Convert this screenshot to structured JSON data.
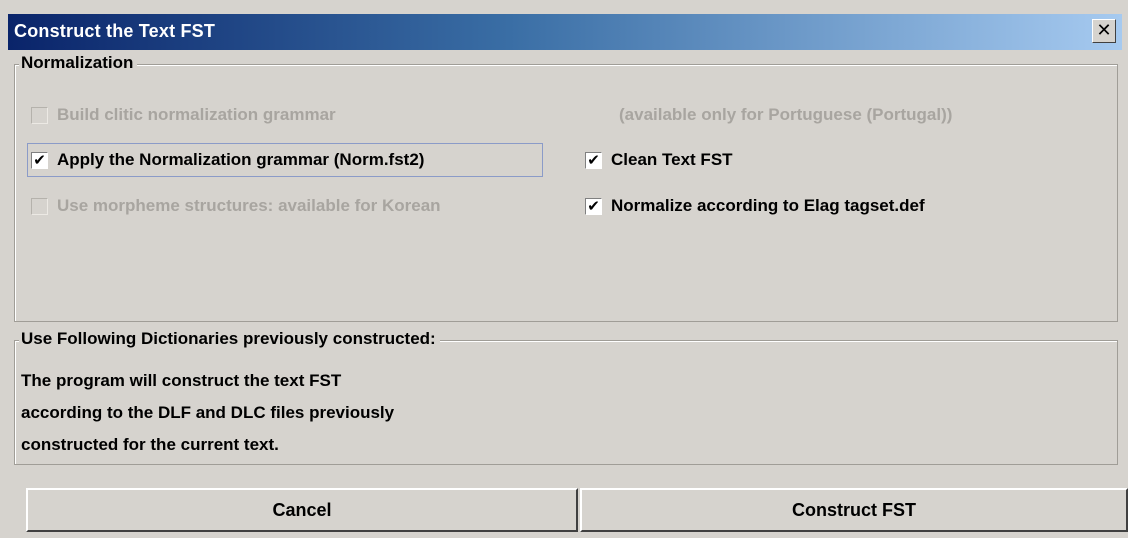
{
  "window": {
    "title": "Construct the Text FST",
    "close_glyph": "✕"
  },
  "normalization": {
    "legend": "Normalization",
    "build_clitic": {
      "label": "Build clitic normalization grammar",
      "checked": false,
      "enabled": false
    },
    "build_clitic_note": "(available only for Portuguese (Portugal))",
    "apply_norm": {
      "label": "Apply the Normalization grammar (Norm.fst2)",
      "checked": true,
      "enabled": true
    },
    "clean_text": {
      "label": "Clean Text FST",
      "checked": true,
      "enabled": true
    },
    "morpheme": {
      "label": "Use morpheme structures: available for Korean",
      "checked": false,
      "enabled": false
    },
    "elag": {
      "label": "Normalize according to Elag tagset.def",
      "checked": true,
      "enabled": true
    },
    "check_glyph": "✔"
  },
  "dictionaries": {
    "legend": "Use Following Dictionaries previously constructed:",
    "line1": "The program will construct the text FST",
    "line2": "according to the DLF and DLC files previously",
    "line3": "constructed for the current text."
  },
  "buttons": {
    "cancel": "Cancel",
    "construct": "Construct FST"
  },
  "colors": {
    "background": "#d6d3ce",
    "title_gradient_start": "#0a246a",
    "title_gradient_end": "#a6caf0",
    "disabled_text": "#a8a5a0"
  }
}
